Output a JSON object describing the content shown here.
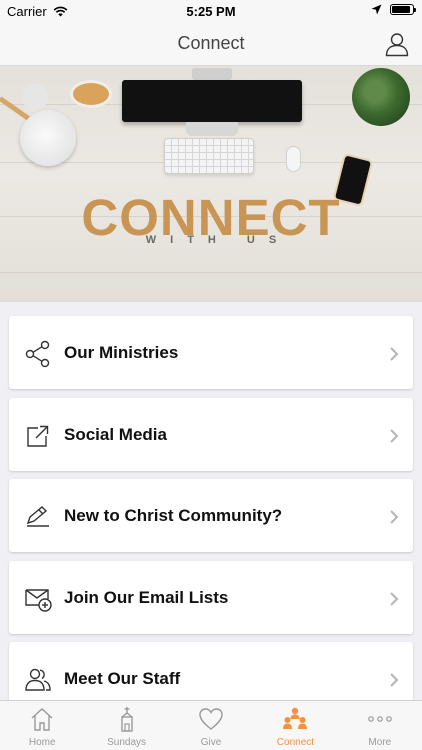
{
  "status_bar": {
    "carrier": "Carrier",
    "time": "5:25 PM",
    "battery_level": 0.92
  },
  "nav": {
    "title": "Connect",
    "profile_icon": "person-icon"
  },
  "hero": {
    "title": "CONNECT",
    "subtitle": "WITH US"
  },
  "menu": {
    "items": [
      {
        "label": "Our Ministries",
        "icon": "share-icon"
      },
      {
        "label": "Social Media",
        "icon": "external-link-icon"
      },
      {
        "label": "New to Christ Community?",
        "icon": "pencil-icon"
      },
      {
        "label": "Join Our Email Lists",
        "icon": "mail-add-icon"
      },
      {
        "label": "Meet Our Staff",
        "icon": "people-icon"
      }
    ]
  },
  "tabs": [
    {
      "label": "Home",
      "icon": "home-icon",
      "active": false
    },
    {
      "label": "Sundays",
      "icon": "church-icon",
      "active": false
    },
    {
      "label": "Give",
      "icon": "heart-icon",
      "active": false
    },
    {
      "label": "Connect",
      "icon": "group-icon",
      "active": true
    },
    {
      "label": "More",
      "icon": "more-icon",
      "active": false
    }
  ],
  "colors": {
    "accent": "#f5923e",
    "hero_text": "#c89554",
    "tab_inactive": "#9a9a9a"
  }
}
